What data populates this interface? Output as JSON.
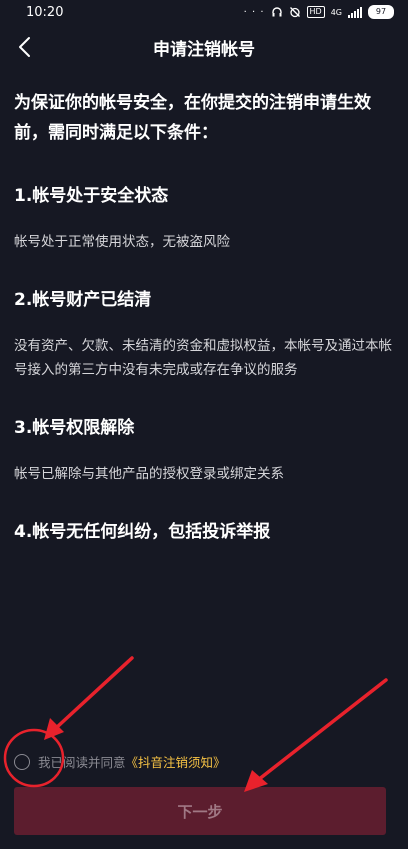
{
  "statusbar": {
    "time": "10:20",
    "dots": "· · ·",
    "hd": "HD",
    "network": "4G",
    "battery": "97"
  },
  "header": {
    "title": "申请注销帐号"
  },
  "intro": "为保证你的帐号安全，在你提交的注销申请生效前，需同时满足以下条件：",
  "conditions": [
    {
      "title": "1.帐号处于安全状态",
      "desc": "帐号处于正常使用状态，无被盗风险"
    },
    {
      "title": "2.帐号财产已结清",
      "desc": "没有资产、欠款、未结清的资金和虚拟权益，本帐号及通过本帐号接入的第三方中没有未完成或存在争议的服务"
    },
    {
      "title": "3.帐号权限解除",
      "desc": "帐号已解除与其他产品的授权登录或绑定关系"
    },
    {
      "title": "4.帐号无任何纠纷，包括投诉举报",
      "desc": ""
    }
  ],
  "agreement": {
    "text": "我已阅读并同意",
    "link": "《抖音注销须知》"
  },
  "next_button": "下一步",
  "colors": {
    "background": "#161823",
    "accent_link": "#f6c244",
    "button_bg": "#5c1d2e",
    "annotation": "#e8222c"
  }
}
